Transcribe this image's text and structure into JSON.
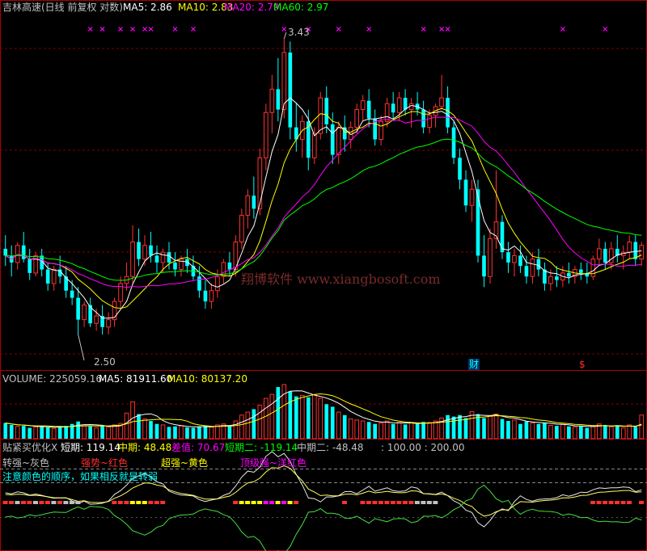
{
  "colors": {
    "up": "#ff3232",
    "down": "#00ffff",
    "frame": "#b00000",
    "grid": "#800000",
    "ma5": "#ffffff",
    "ma10": "#ffff00",
    "ma20": "#ff00ff",
    "ma60": "#00ff00",
    "cross": "#ff00ff",
    "cyan": "#00ffff",
    "red": "#ff3030",
    "yellow": "#ffff00",
    "magenta": "#ff00ff",
    "green": "#00ff00",
    "white": "#ffffff",
    "gray": "#c0c0c0",
    "ind_white": "#e8e8e8",
    "ind_yellow": "#ffff66",
    "ind_green": "#44dd44"
  },
  "header": {
    "title": "吉林高速(日线 前复权 对数)",
    "ma5": "MA5: 2.86",
    "ma10": "MA10: 2.83",
    "ma20": "MA20: 2.79",
    "ma60": "MA60: 2.97"
  },
  "price_labels": {
    "high": "3.43",
    "low": "2.50"
  },
  "event_marks": {
    "cai": "财",
    "money": "$"
  },
  "watermark": "翔博软件 www.xiangbosoft.com",
  "volume_header": {
    "volume": "VOLUME: 225059.16",
    "ma5": "MA5: 81911.60",
    "ma10": "MA10: 80137.20"
  },
  "indicator_header": {
    "name": "贴紧买优化X",
    "short": "短期: 119.14",
    "mid": "中期: 48.48",
    "diff": "差值: 70.67",
    "short2": "短期二: -119.14",
    "mid2": "中期二: -48.48",
    "lv": ": 100.00 : 200.00"
  },
  "legend": {
    "gray": "转强~灰色",
    "red": "强势~红色",
    "yellow": "超强~黄色",
    "magenta": "顶级强~洋红色",
    "note": "注意颜色的顺序，如果相反就是转弱"
  },
  "chart_data": {
    "type": "candlestick",
    "title": "吉林高速(日线 前复权 对数)",
    "yscale": "log",
    "price_range": [
      2.5,
      3.43
    ],
    "moving_averages": {
      "MA5": 2.86,
      "MA10": 2.83,
      "MA20": 2.79,
      "MA60": 2.97
    },
    "volume": {
      "VOLUME": 225059.16,
      "MA5": 81911.6,
      "MA10": 80137.2
    },
    "indicator": {
      "短期": 119.14,
      "中期": 48.48,
      "差值": 70.67,
      "短期二": -119.14,
      "中期二": -48.48
    },
    "candles": [
      [
        2.74,
        2.78,
        2.69,
        2.72
      ],
      [
        2.72,
        2.75,
        2.66,
        2.7
      ],
      [
        2.7,
        2.76,
        2.68,
        2.75
      ],
      [
        2.75,
        2.79,
        2.7,
        2.71
      ],
      [
        2.71,
        2.74,
        2.65,
        2.67
      ],
      [
        2.67,
        2.73,
        2.66,
        2.72
      ],
      [
        2.72,
        2.74,
        2.66,
        2.68
      ],
      [
        2.68,
        2.7,
        2.62,
        2.64
      ],
      [
        2.64,
        2.69,
        2.62,
        2.68
      ],
      [
        2.68,
        2.72,
        2.64,
        2.66
      ],
      [
        2.66,
        2.69,
        2.6,
        2.62
      ],
      [
        2.62,
        2.65,
        2.58,
        2.6
      ],
      [
        2.6,
        2.63,
        2.5,
        2.54
      ],
      [
        2.54,
        2.59,
        2.52,
        2.58
      ],
      [
        2.58,
        2.6,
        2.52,
        2.53
      ],
      [
        2.53,
        2.57,
        2.51,
        2.55
      ],
      [
        2.55,
        2.58,
        2.5,
        2.52
      ],
      [
        2.52,
        2.56,
        2.5,
        2.54
      ],
      [
        2.54,
        2.6,
        2.52,
        2.59
      ],
      [
        2.59,
        2.66,
        2.57,
        2.64
      ],
      [
        2.64,
        2.7,
        2.62,
        2.66
      ],
      [
        2.66,
        2.81,
        2.64,
        2.76
      ],
      [
        2.76,
        2.8,
        2.69,
        2.71
      ],
      [
        2.71,
        2.78,
        2.69,
        2.75
      ],
      [
        2.75,
        2.79,
        2.7,
        2.72
      ],
      [
        2.72,
        2.75,
        2.67,
        2.7
      ],
      [
        2.7,
        2.74,
        2.67,
        2.73
      ],
      [
        2.73,
        2.76,
        2.68,
        2.7
      ],
      [
        2.7,
        2.73,
        2.66,
        2.68
      ],
      [
        2.68,
        2.72,
        2.66,
        2.71
      ],
      [
        2.71,
        2.74,
        2.67,
        2.69
      ],
      [
        2.69,
        2.72,
        2.65,
        2.66
      ],
      [
        2.66,
        2.69,
        2.6,
        2.62
      ],
      [
        2.62,
        2.65,
        2.57,
        2.59
      ],
      [
        2.59,
        2.64,
        2.57,
        2.62
      ],
      [
        2.62,
        2.68,
        2.6,
        2.66
      ],
      [
        2.66,
        2.71,
        2.64,
        2.7
      ],
      [
        2.7,
        2.73,
        2.66,
        2.68
      ],
      [
        2.68,
        2.78,
        2.66,
        2.76
      ],
      [
        2.76,
        2.86,
        2.74,
        2.84
      ],
      [
        2.84,
        2.92,
        2.8,
        2.9
      ],
      [
        2.9,
        2.96,
        2.83,
        2.86
      ],
      [
        2.86,
        3.05,
        2.84,
        3.02
      ],
      [
        3.02,
        3.2,
        2.98,
        3.17
      ],
      [
        3.17,
        3.3,
        3.1,
        3.25
      ],
      [
        3.25,
        3.36,
        3.14,
        3.18
      ],
      [
        3.18,
        3.43,
        3.15,
        3.38
      ],
      [
        3.38,
        3.42,
        3.08,
        3.12
      ],
      [
        3.12,
        3.2,
        3.04,
        3.08
      ],
      [
        3.08,
        3.16,
        3.02,
        3.14
      ],
      [
        3.14,
        3.18,
        2.98,
        3.02
      ],
      [
        3.02,
        3.12,
        3.0,
        3.1
      ],
      [
        3.1,
        3.24,
        3.08,
        3.22
      ],
      [
        3.22,
        3.26,
        3.1,
        3.13
      ],
      [
        3.13,
        3.17,
        3.0,
        3.03
      ],
      [
        3.03,
        3.14,
        3.0,
        3.12
      ],
      [
        3.12,
        3.16,
        3.04,
        3.08
      ],
      [
        3.08,
        3.14,
        3.05,
        3.12
      ],
      [
        3.12,
        3.2,
        3.1,
        3.18
      ],
      [
        3.18,
        3.23,
        3.14,
        3.21
      ],
      [
        3.21,
        3.25,
        3.12,
        3.15
      ],
      [
        3.15,
        3.18,
        3.06,
        3.08
      ],
      [
        3.08,
        3.16,
        3.06,
        3.14
      ],
      [
        3.14,
        3.22,
        3.12,
        3.2
      ],
      [
        3.2,
        3.24,
        3.15,
        3.17
      ],
      [
        3.17,
        3.24,
        3.14,
        3.22
      ],
      [
        3.22,
        3.25,
        3.16,
        3.18
      ],
      [
        3.18,
        3.22,
        3.12,
        3.2
      ],
      [
        3.2,
        3.24,
        3.16,
        3.18
      ],
      [
        3.18,
        3.21,
        3.1,
        3.12
      ],
      [
        3.12,
        3.18,
        3.1,
        3.16
      ],
      [
        3.16,
        3.2,
        3.12,
        3.19
      ],
      [
        3.19,
        3.3,
        3.18,
        3.22
      ],
      [
        3.22,
        3.26,
        3.1,
        3.12
      ],
      [
        3.12,
        3.14,
        3.0,
        3.02
      ],
      [
        3.02,
        3.05,
        2.92,
        2.95
      ],
      [
        2.95,
        2.98,
        2.85,
        2.87
      ],
      [
        2.87,
        2.95,
        2.82,
        2.92
      ],
      [
        2.92,
        2.95,
        2.7,
        2.72
      ],
      [
        2.72,
        2.78,
        2.63,
        2.66
      ],
      [
        2.66,
        2.8,
        2.64,
        2.77
      ],
      [
        2.77,
        2.98,
        2.74,
        2.82
      ],
      [
        2.82,
        2.84,
        2.71,
        2.73
      ],
      [
        2.73,
        2.76,
        2.67,
        2.7
      ],
      [
        2.7,
        2.74,
        2.66,
        2.72
      ],
      [
        2.72,
        2.75,
        2.67,
        2.69
      ],
      [
        2.69,
        2.72,
        2.64,
        2.66
      ],
      [
        2.66,
        2.73,
        2.64,
        2.71
      ],
      [
        2.71,
        2.74,
        2.66,
        2.68
      ],
      [
        2.68,
        2.7,
        2.62,
        2.64
      ],
      [
        2.64,
        2.68,
        2.62,
        2.66
      ],
      [
        2.66,
        2.69,
        2.63,
        2.65
      ],
      [
        2.65,
        2.69,
        2.63,
        2.67
      ],
      [
        2.67,
        2.7,
        2.64,
        2.66
      ],
      [
        2.66,
        2.69,
        2.64,
        2.68
      ],
      [
        2.68,
        2.7,
        2.65,
        2.67
      ],
      [
        2.67,
        2.7,
        2.64,
        2.66
      ],
      [
        2.66,
        2.72,
        2.65,
        2.71
      ],
      [
        2.71,
        2.77,
        2.69,
        2.74
      ],
      [
        2.74,
        2.76,
        2.68,
        2.7
      ],
      [
        2.7,
        2.76,
        2.68,
        2.74
      ],
      [
        2.74,
        2.78,
        2.7,
        2.72
      ],
      [
        2.72,
        2.75,
        2.68,
        2.73
      ],
      [
        2.73,
        2.78,
        2.71,
        2.76
      ],
      [
        2.76,
        2.78,
        2.69,
        2.71
      ],
      [
        2.71,
        2.76,
        2.69,
        2.75
      ]
    ],
    "volumes": [
      3.2,
      2.8,
      2.5,
      2.6,
      2.2,
      2.4,
      2.6,
      2.3,
      2.1,
      2.4,
      2.6,
      3.0,
      3.5,
      2.8,
      2.5,
      2.2,
      2.6,
      2.4,
      2.8,
      3.1,
      5.2,
      7.5,
      5.0,
      4.0,
      3.6,
      3.0,
      2.8,
      2.4,
      2.5,
      2.6,
      2.3,
      2.2,
      2.5,
      2.6,
      2.4,
      2.8,
      3.0,
      2.6,
      3.6,
      4.8,
      5.4,
      6.0,
      6.8,
      8.2,
      9.0,
      10.5,
      11.0,
      9.6,
      8.6,
      8.8,
      8.4,
      8.9,
      8.2,
      7.0,
      6.5,
      5.4,
      4.8,
      4.0,
      3.8,
      3.6,
      3.4,
      3.0,
      3.2,
      3.6,
      3.0,
      3.3,
      2.9,
      3.2,
      3.0,
      3.4,
      3.3,
      3.6,
      4.2,
      4.8,
      4.5,
      4.8,
      4.2,
      5.5,
      5.0,
      4.2,
      4.6,
      5.0,
      4.0,
      3.6,
      3.8,
      3.0,
      3.5,
      3.2,
      3.0,
      3.3,
      2.7,
      2.6,
      2.9,
      2.5,
      2.4,
      2.6,
      2.2,
      2.6,
      3.0,
      2.8,
      2.4,
      2.6,
      2.2,
      2.8,
      2.4,
      4.8
    ]
  }
}
